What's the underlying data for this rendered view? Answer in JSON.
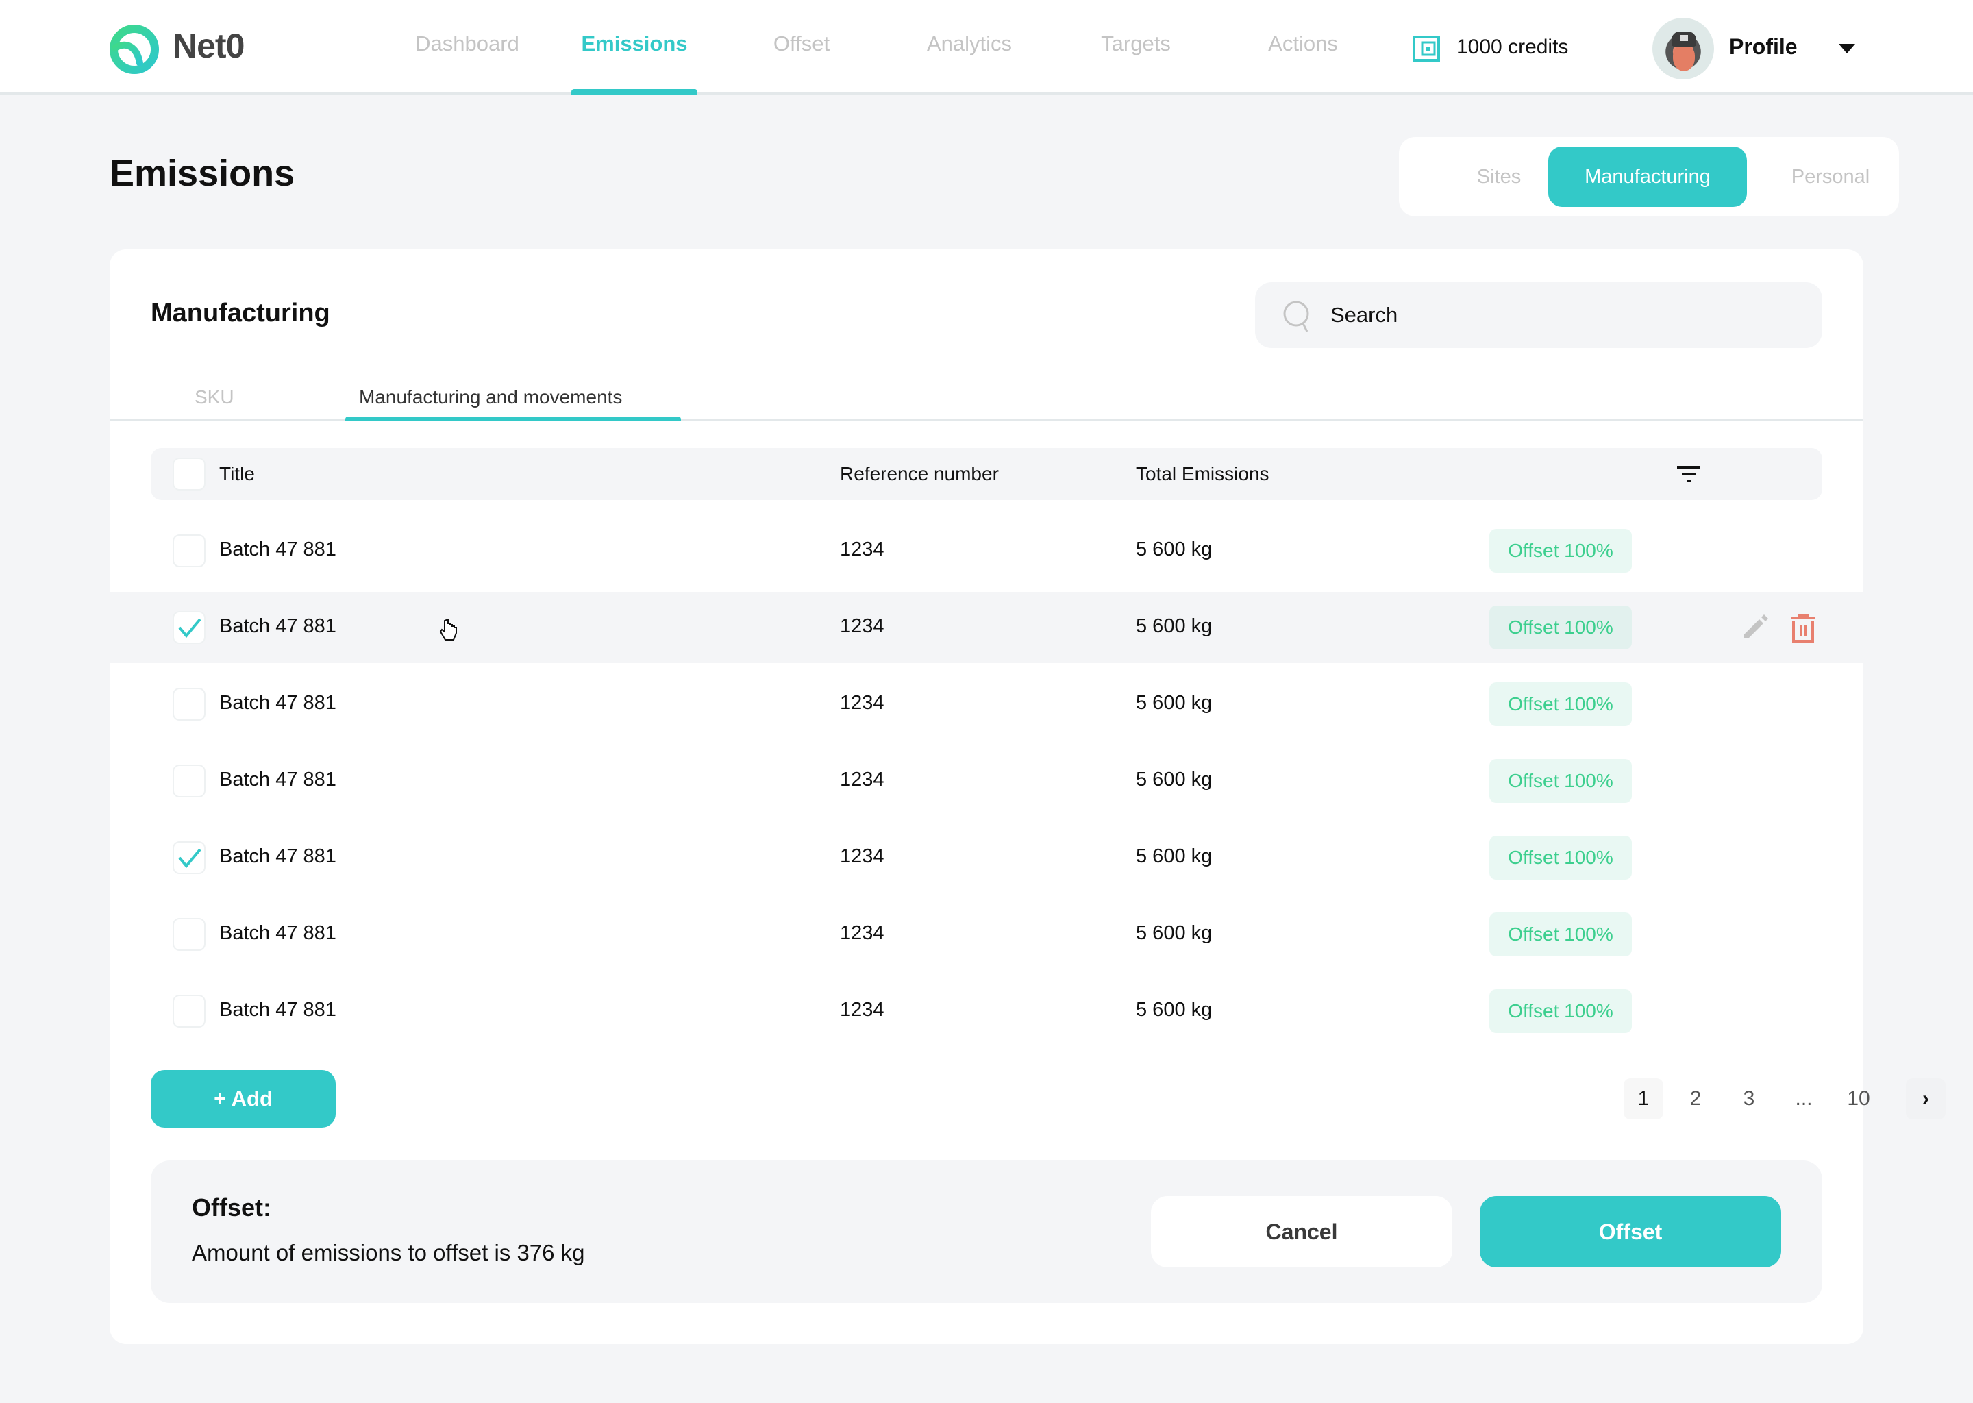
{
  "header": {
    "brand": "Net0",
    "nav": [
      {
        "label": "Dashboard",
        "active": false
      },
      {
        "label": "Emissions",
        "active": true
      },
      {
        "label": "Offset",
        "active": false
      },
      {
        "label": "Analytics",
        "active": false
      },
      {
        "label": "Targets",
        "active": false
      },
      {
        "label": "Actions",
        "active": false
      }
    ],
    "credits": "1000 credits",
    "credits_icon": "wallet-icon",
    "profile_label": "Profile",
    "profile_caret_icon": "caret-down-icon"
  },
  "page": {
    "title": "Emissions",
    "segments": [
      {
        "label": "Sites",
        "active": false
      },
      {
        "label": "Manufacturing",
        "active": true
      },
      {
        "label": "Personal",
        "active": false
      }
    ]
  },
  "card": {
    "title": "Manufacturing",
    "search": {
      "placeholder": "Search",
      "value": ""
    },
    "subtabs": [
      {
        "label": "SKU",
        "active": false
      },
      {
        "label": "Manufacturing and movements",
        "active": true
      }
    ],
    "table": {
      "columns": [
        "Title",
        "Reference number",
        "Total Emissions"
      ],
      "rows": [
        {
          "title": "Batch 47 881",
          "reference": "1234",
          "emissions": "5 600 kg",
          "status": "Offset 100%",
          "checked": false,
          "hovered": false
        },
        {
          "title": "Batch 47 881",
          "reference": "1234",
          "emissions": "5 600 kg",
          "status": "Offset 100%",
          "checked": true,
          "hovered": true
        },
        {
          "title": "Batch 47 881",
          "reference": "1234",
          "emissions": "5 600 kg",
          "status": "Offset 100%",
          "checked": false,
          "hovered": false
        },
        {
          "title": "Batch 47 881",
          "reference": "1234",
          "emissions": "5 600 kg",
          "status": "Offset 100%",
          "checked": false,
          "hovered": false
        },
        {
          "title": "Batch 47 881",
          "reference": "1234",
          "emissions": "5 600 kg",
          "status": "Offset 100%",
          "checked": true,
          "hovered": false
        },
        {
          "title": "Batch 47 881",
          "reference": "1234",
          "emissions": "5 600 kg",
          "status": "Offset 100%",
          "checked": false,
          "hovered": false
        },
        {
          "title": "Batch 47 881",
          "reference": "1234",
          "emissions": "5 600 kg",
          "status": "Offset 100%",
          "checked": false,
          "hovered": false
        }
      ]
    },
    "add_label": "+ Add",
    "pagination": {
      "pages": [
        "1",
        "2",
        "3",
        "...",
        "10"
      ],
      "current": "1",
      "next_icon": "chevron-right-icon",
      "next_label": "›"
    },
    "offset_panel": {
      "title": "Offset:",
      "description": "Amount of emissions to offset is 376 kg",
      "cancel_label": "Cancel",
      "offset_label": "Offset"
    }
  },
  "colors": {
    "accent": "#33c9c8",
    "badge_text": "#3ccf8e",
    "badge_bg": "#e9f8f3",
    "delete": "#e8806f",
    "muted": "#c4c4c4",
    "background": "#f4f5f7"
  }
}
